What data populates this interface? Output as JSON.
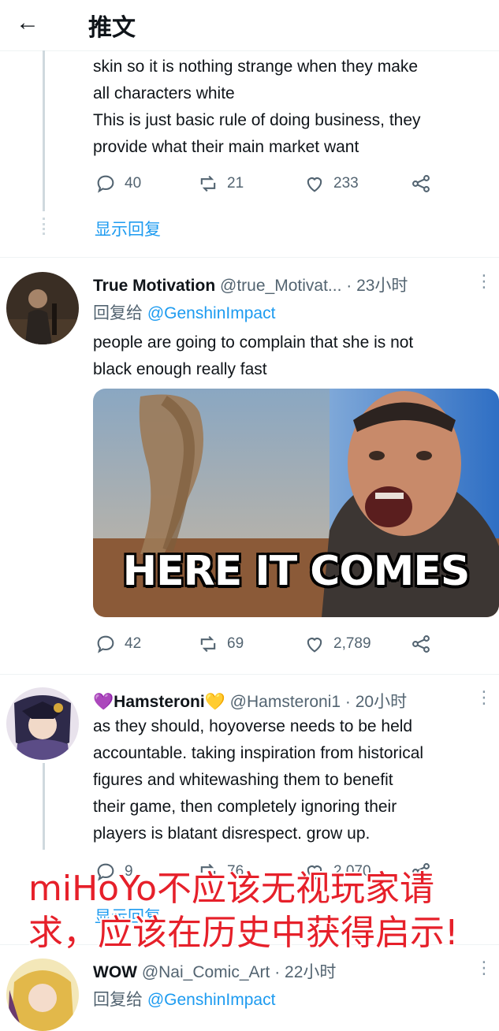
{
  "header": {
    "title": "推文"
  },
  "tweet_top": {
    "text": "skin so it is nothing strange when they make\nall characters white\nThis is just basic rule of doing business, they\nprovide what their main market want",
    "replies": "40",
    "retweets": "21",
    "likes": "233",
    "show_replies": "显示回复"
  },
  "tweet_true_motivation": {
    "display_name": "True Motivation",
    "handle": "@true_Motivat...",
    "time": "· 23小时",
    "reply_prefix": "回复给",
    "reply_to": "@GenshinImpact",
    "text": "people are going to complain that she is not\nblack enough really fast",
    "meme_caption": "HERE IT COMES",
    "replies": "42",
    "retweets": "69",
    "likes": "2,789"
  },
  "tweet_hamsteroni": {
    "display_name": "💜Hamsteroni💛",
    "handle": "@Hamsteroni1",
    "time": "· 20小时",
    "text": "as they should, hoyoverse needs to be held\naccountable. taking inspiration from historical\nfigures and whitewashing them to benefit\ntheir game, then completely ignoring their\nplayers is blatant disrespect. grow up.",
    "replies": "9",
    "retweets": "76",
    "likes": "2,070",
    "show_replies": "显示回复"
  },
  "overlay": {
    "line1": "miHoYo不应该无视玩家请",
    "line2": "求，应该在历史中获得启示!"
  },
  "tweet_wow": {
    "display_name": "WOW",
    "handle": "@Nai_Comic_Art",
    "time": "· 22小时",
    "reply_prefix": "回复给",
    "reply_to": "@GenshinImpact"
  },
  "colors": {
    "accent": "#1d9bf0",
    "overlay_red": "#e6202a",
    "muted": "#536471"
  }
}
